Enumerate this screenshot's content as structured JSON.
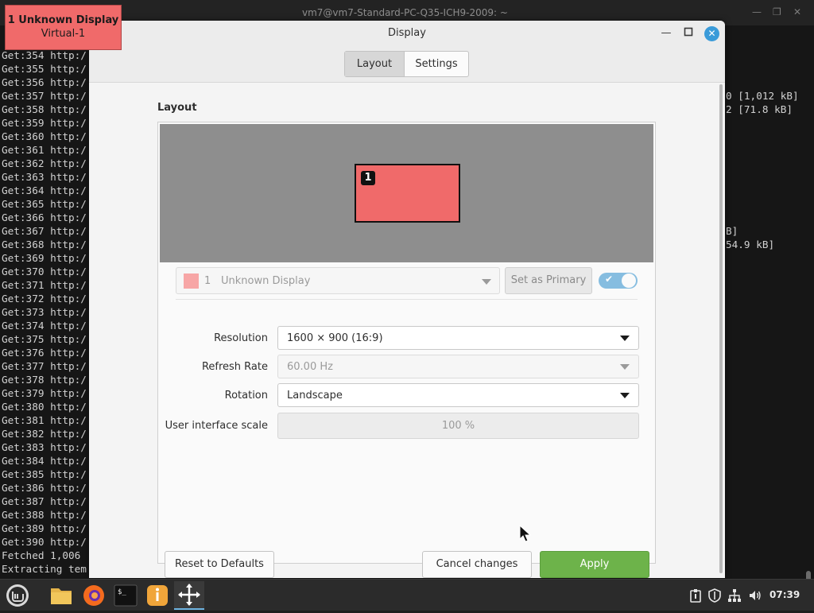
{
  "terminal": {
    "title": "vm7@vm7-Standard-PC-Q35-ICH9-2009: ~",
    "lines": [
      "Get:354 http:/",
      "Get:355 http:/",
      "Get:356 http:/",
      "Get:357 http:/",
      "Get:358 http:/",
      "Get:359 http:/",
      "Get:360 http:/",
      "Get:361 http:/",
      "Get:362 http:/",
      "Get:363 http:/",
      "Get:364 http:/",
      "Get:365 http:/",
      "Get:366 http:/",
      "Get:367 http:/",
      "Get:368 http:/",
      "Get:369 http:/",
      "Get:370 http:/",
      "Get:371 http:/",
      "Get:372 http:/",
      "Get:373 http:/",
      "Get:374 http:/",
      "Get:375 http:/",
      "Get:376 http:/",
      "Get:377 http:/",
      "Get:378 http:/",
      "Get:379 http:/",
      "Get:380 http:/",
      "Get:381 http:/",
      "Get:382 http:/",
      "Get:383 http:/",
      "Get:384 http:/",
      "Get:385 http:/",
      "Get:386 http:/",
      "Get:387 http:/",
      "Get:388 http:/",
      "Get:389 http:/",
      "Get:390 http:/",
      "Fetched 1,006",
      "Extracting tem"
    ],
    "right_fragments": [
      "0 [1,012 kB]",
      "2 [71.8 kB]",
      "B]",
      "54.9 kB]"
    ]
  },
  "overlay": {
    "title": "1  Unknown Display",
    "subtitle": "Virtual-1"
  },
  "dialog": {
    "title": "Display",
    "tabs": [
      "Layout",
      "Settings"
    ],
    "section_title": "Layout",
    "monitor_number": "1",
    "monitor_select": {
      "number": "1",
      "name": "Unknown Display"
    },
    "set_primary_label": "Set as Primary",
    "enabled": true,
    "resolution": {
      "label": "Resolution",
      "value": "1600 × 900 (16:9)"
    },
    "refresh_rate": {
      "label": "Refresh Rate",
      "value": "60.00 Hz"
    },
    "rotation": {
      "label": "Rotation",
      "value": "Landscape"
    },
    "ui_scale": {
      "label": "User interface scale",
      "value": "100 %"
    },
    "buttons": {
      "reset": "Reset to Defaults",
      "cancel": "Cancel changes",
      "apply": "Apply"
    }
  },
  "taskbar": {
    "apps": [
      "mint-menu-icon",
      "files-icon",
      "firefox-icon",
      "terminal-icon",
      "info-icon",
      "display-settings-icon"
    ],
    "clock": "07:39"
  },
  "colors": {
    "accent": "#3a9bd9",
    "monitor": "#f06a6a",
    "apply": "#6db34a"
  }
}
